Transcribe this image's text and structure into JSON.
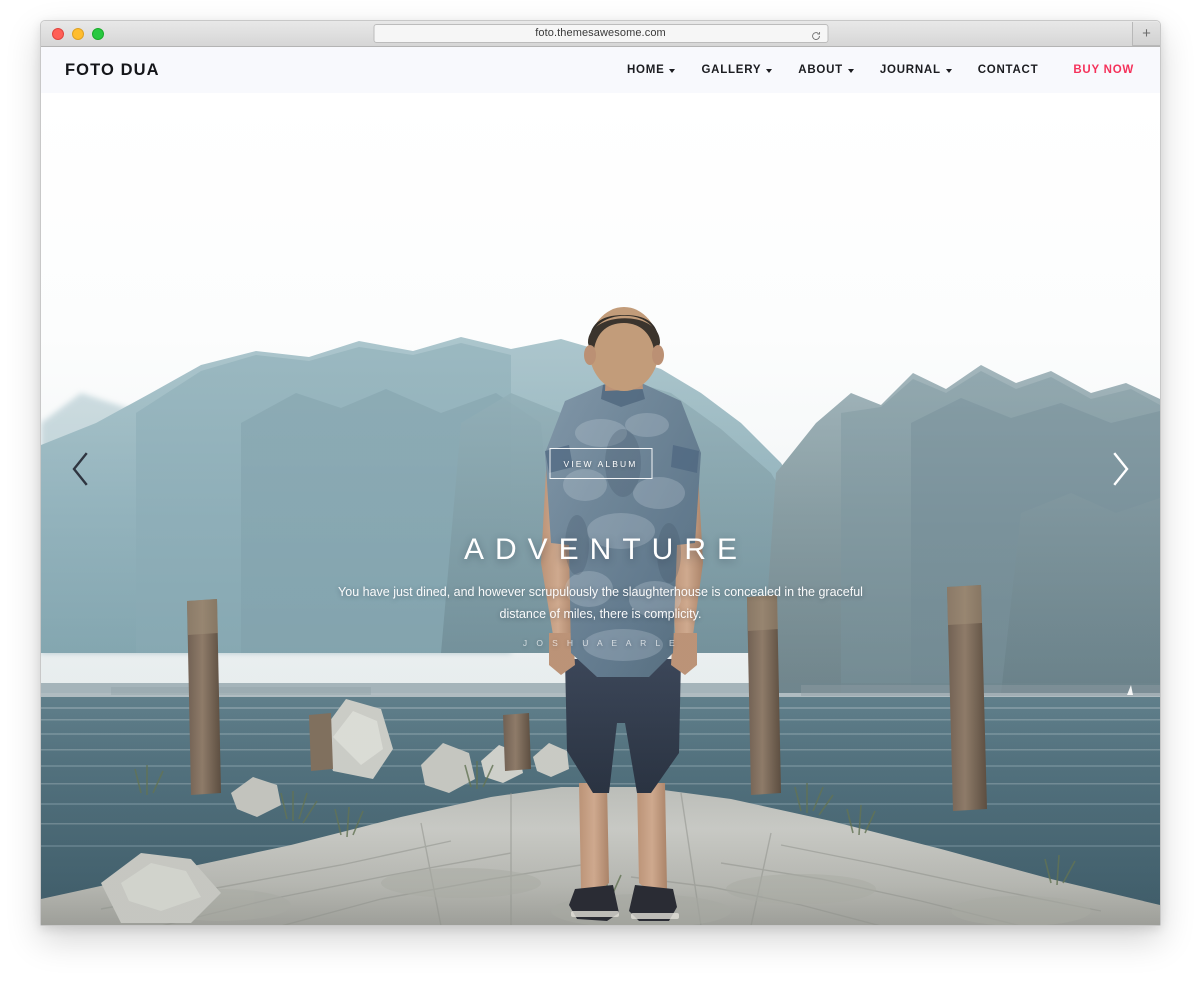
{
  "browser": {
    "url": "foto.themesawesome.com",
    "reload_icon": "reload-icon",
    "newtab_label": "+",
    "traffic_lights": [
      "close",
      "minimize",
      "maximize"
    ]
  },
  "site": {
    "brand": "FOTO DUA",
    "nav": [
      {
        "label": "HOME",
        "has_caret": true
      },
      {
        "label": "GALLERY",
        "has_caret": true
      },
      {
        "label": "ABOUT",
        "has_caret": true
      },
      {
        "label": "JOURNAL",
        "has_caret": true
      },
      {
        "label": "CONTACT",
        "has_caret": false
      }
    ],
    "cta": {
      "label": "BUY NOW",
      "color": "#f5325b"
    },
    "hero": {
      "button_label": "VIEW ALBUM",
      "title": "ADVENTURE",
      "quote": "You have just dined, and however scrupulously the slaughterhouse is concealed in the graceful distance of miles, there is complicity.",
      "author": "J O S H U A   E A R L E",
      "prev_icon": "chevron-left-icon",
      "next_icon": "chevron-right-icon"
    }
  },
  "colors": {
    "accent": "#f5325b",
    "navbar_bg": "#f8f9fd",
    "text": "#1b1c20",
    "water": "#3e5a68",
    "mountain": "#8fb0bb",
    "sky": "#fdfdfd",
    "stone": "#c9c8c4"
  }
}
